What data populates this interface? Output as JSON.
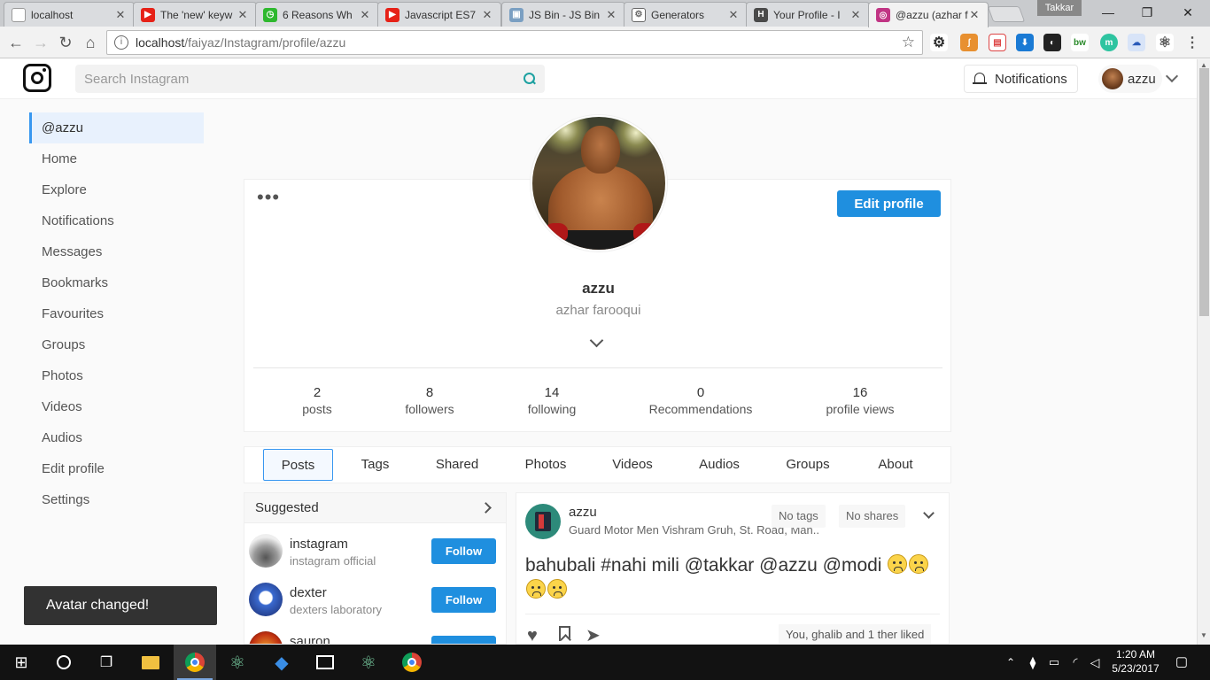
{
  "browser": {
    "tabs": [
      {
        "title": "localhost",
        "favicon_color": "#999999",
        "active": false
      },
      {
        "title": "The 'new' keyw",
        "favicon_color": "#e62117",
        "active": false
      },
      {
        "title": "6 Reasons Wh",
        "favicon_color": "#2eb82e",
        "active": false
      },
      {
        "title": "Javascript ES7",
        "favicon_color": "#e62117",
        "active": false
      },
      {
        "title": "JS Bin - JS Bin",
        "favicon_color": "#7a9fc2",
        "active": false
      },
      {
        "title": "Generators",
        "favicon_color": "#666666",
        "active": false
      },
      {
        "title": "Your Profile - I",
        "favicon_color": "#4a4a4a",
        "active": false
      },
      {
        "title": "@azzu (azhar f",
        "favicon_color": "#c13584",
        "active": true
      }
    ],
    "profile_badge": "Takkar",
    "url_host": "localhost",
    "url_path": "/faiyaz/Instagram/profile/azzu"
  },
  "header": {
    "search_placeholder": "Search Instagram",
    "notifications_label": "Notifications",
    "username": "azzu"
  },
  "sidebar": {
    "items": [
      {
        "label": "@azzu",
        "active": true
      },
      {
        "label": "Home"
      },
      {
        "label": "Explore"
      },
      {
        "label": "Notifications"
      },
      {
        "label": "Messages"
      },
      {
        "label": "Bookmarks"
      },
      {
        "label": "Favourites"
      },
      {
        "label": "Groups"
      },
      {
        "label": "Photos"
      },
      {
        "label": "Videos"
      },
      {
        "label": "Audios"
      },
      {
        "label": "Edit profile"
      },
      {
        "label": "Settings"
      }
    ]
  },
  "profile": {
    "options_icon": "more-dots",
    "edit_label": "Edit profile",
    "username": "azzu",
    "fullname": "azhar farooqui",
    "stats": [
      {
        "value": "2",
        "label": "posts"
      },
      {
        "value": "8",
        "label": "followers"
      },
      {
        "value": "14",
        "label": "following"
      },
      {
        "value": "0",
        "label": "Recommendations"
      },
      {
        "value": "16",
        "label": "profile views"
      }
    ]
  },
  "tabs": [
    {
      "label": "Posts",
      "active": true
    },
    {
      "label": "Tags"
    },
    {
      "label": "Shared"
    },
    {
      "label": "Photos"
    },
    {
      "label": "Videos"
    },
    {
      "label": "Audios"
    },
    {
      "label": "Groups"
    },
    {
      "label": "About"
    }
  ],
  "suggested": {
    "title": "Suggested",
    "follow_label": "Follow",
    "items": [
      {
        "name": "instagram",
        "sub": "instagram official"
      },
      {
        "name": "dexter",
        "sub": "dexters laboratory"
      },
      {
        "name": "sauron",
        "sub": ""
      }
    ]
  },
  "post": {
    "username": "azzu",
    "location": "Guard Motor Men Vishram Gruh, St. Road, Man..",
    "tags_chip": "No tags",
    "shares_chip": "No shares",
    "text": "bahubali #nahi mili @takkar @azzu @modi",
    "likes": "You, ghalib and 1 ther liked"
  },
  "toast": "Avatar changed!",
  "taskbar": {
    "time": "1:20 AM",
    "date": "5/23/2017"
  },
  "colors": {
    "accent": "#1f8fdf",
    "sidebar_active_bg": "#e8f1fd",
    "toast_bg": "#323232"
  }
}
